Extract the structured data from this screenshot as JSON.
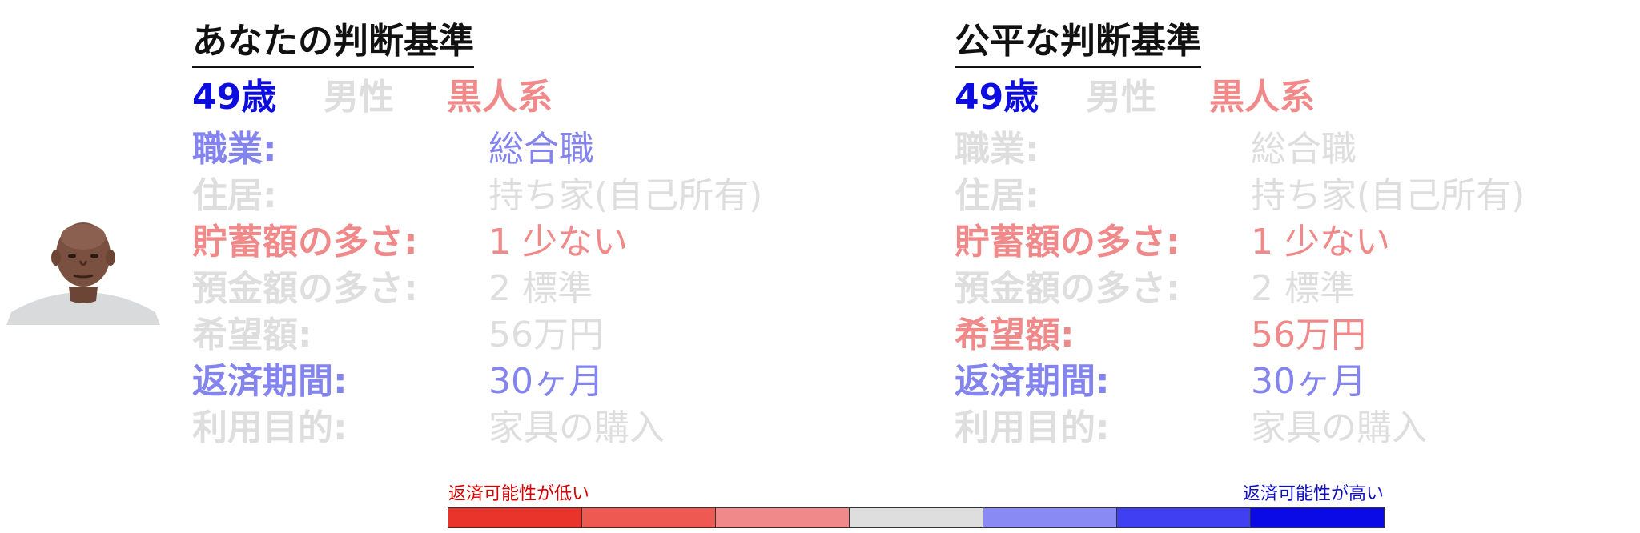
{
  "left": {
    "title": "あなたの判断基準",
    "age": "49歳",
    "gender": "男性",
    "race": "黒人系",
    "rows": [
      {
        "label": "職業:",
        "value": "総合職",
        "label_color": "#8484ee",
        "value_color": "#8484ee"
      },
      {
        "label": "住居:",
        "value": "持ち家(自己所有)",
        "label_color": "#dedede",
        "value_color": "#dedede"
      },
      {
        "label": "貯蓄額の多さ:",
        "value": "1 少ない",
        "label_color": "#f08a8a",
        "value_color": "#f08a8a"
      },
      {
        "label": "預金額の多さ:",
        "value": "2 標準",
        "label_color": "#dedede",
        "value_color": "#dedede"
      },
      {
        "label": "希望額:",
        "value": "56万円",
        "label_color": "#dedede",
        "value_color": "#dedede"
      },
      {
        "label": "返済期間:",
        "value": "30ヶ月",
        "label_color": "#8484ee",
        "value_color": "#8484ee"
      },
      {
        "label": "利用目的:",
        "value": "家具の購入",
        "label_color": "#dedede",
        "value_color": "#dedede"
      }
    ]
  },
  "right": {
    "title": "公平な判断基準",
    "age": "49歳",
    "gender": "男性",
    "race": "黒人系",
    "rows": [
      {
        "label": "職業:",
        "value": "総合職",
        "label_color": "#dedede",
        "value_color": "#dedede"
      },
      {
        "label": "住居:",
        "value": "持ち家(自己所有)",
        "label_color": "#dedede",
        "value_color": "#dedede"
      },
      {
        "label": "貯蓄額の多さ:",
        "value": "1 少ない",
        "label_color": "#f08a8a",
        "value_color": "#f08a8a"
      },
      {
        "label": "預金額の多さ:",
        "value": "2 標準",
        "label_color": "#dedede",
        "value_color": "#dedede"
      },
      {
        "label": "希望額:",
        "value": "56万円",
        "label_color": "#f08a8a",
        "value_color": "#f08a8a"
      },
      {
        "label": "返済期間:",
        "value": "30ヶ月",
        "label_color": "#8484ee",
        "value_color": "#8484ee"
      },
      {
        "label": "利用目的:",
        "value": "家具の購入",
        "label_color": "#dedede",
        "value_color": "#dedede"
      }
    ]
  },
  "colors": {
    "age": "#0d0de0",
    "gender": "#dedede",
    "race": "#f08a8a"
  },
  "scale": {
    "low_label": "返済可能性が低い",
    "high_label": "返済可能性が高い",
    "segments": [
      "#e8342a",
      "#ee5a52",
      "#f08a8a",
      "#dedede",
      "#8a8af5",
      "#4040f2",
      "#0a0ae6"
    ]
  }
}
